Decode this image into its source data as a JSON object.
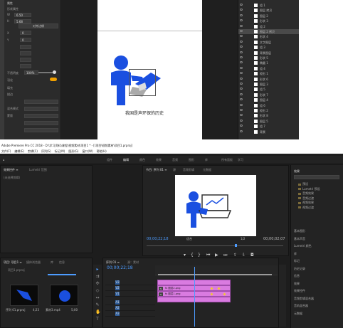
{
  "photoshop": {
    "props_header": "属性",
    "props_title": "形状属性",
    "w_label": "W",
    "w_value": "6.50",
    "h_label": "H",
    "h_value": "5.68",
    "x_label": "X",
    "x_value": "0",
    "y_label": "Y",
    "y_value": "0",
    "align_button": "对齐边缘",
    "opacity_label": "不透明度",
    "opacity_value": "100%",
    "toggle_label": "羽化",
    "fill_label": "填充",
    "stroke_label": "描边",
    "mode_label": "混合模式",
    "mask_label": "蒙版",
    "layers": [
      {
        "label": "组 1",
        "sel": false
      },
      {
        "label": "图层 拷贝",
        "sel": false
      },
      {
        "label": "图层 2",
        "sel": false
      },
      {
        "label": "形状 3",
        "sel": false
      },
      {
        "label": "组 2",
        "sel": false
      },
      {
        "label": "图层 2 拷贝",
        "sel": true
      },
      {
        "label": "形状 4",
        "sel": false
      },
      {
        "label": "文字图层",
        "sel": false
      },
      {
        "label": "组 3",
        "sel": false
      },
      {
        "label": "背景图层",
        "sel": false
      },
      {
        "label": "形状 5",
        "sel": false
      },
      {
        "label": "椭圆 1",
        "sel": false
      },
      {
        "label": "组 4",
        "sel": false
      },
      {
        "label": "矩形 1",
        "sel": false
      },
      {
        "label": "形状 6",
        "sel": false
      },
      {
        "label": "图层 3",
        "sel": false
      },
      {
        "label": "组 5",
        "sel": false
      },
      {
        "label": "形状 7",
        "sel": false
      },
      {
        "label": "图层 4",
        "sel": false
      },
      {
        "label": "组 6",
        "sel": false
      },
      {
        "label": "矩形 2",
        "sel": false
      },
      {
        "label": "形状 8",
        "sel": false
      },
      {
        "label": "图层 5",
        "sel": false
      },
      {
        "label": "组 7",
        "sel": false
      },
      {
        "label": "背景",
        "sel": false
      }
    ],
    "caption": "我国是声环保的历史"
  },
  "premiere": {
    "title": "Adobe Premiere Pro CC 2018 - D:\\学习资料\\课程\\视频素材\\项目1 * - [\\项目\\视频素材\\项目1.prproj]",
    "menu": [
      "文件(F)",
      "编辑(E)",
      "剪辑(C)",
      "序列(S)",
      "标记(M)",
      "图形(G)",
      "窗口(W)",
      "帮助(H)"
    ],
    "workspace_tabs": [
      "组件",
      "编辑",
      "颜色",
      "效果",
      "音频",
      "图形",
      "库",
      "所有面板",
      "学习"
    ],
    "source_tabs": [
      "效果控件 ≡",
      "Lumetri 范围"
    ],
    "source_empty": "(未选择剪辑)",
    "program_tabs": [
      "节目: 序列 01 ≡",
      "源",
      "音频剪辑",
      "元数据"
    ],
    "program_tc_left": "00;00;22;18",
    "program_tc_right": "00;00;02;07",
    "program_zoom": "适合",
    "program_quality": "1/2",
    "timeline_tabs": [
      "序列 01 ≡",
      "源：素材"
    ],
    "timeline_tc": "00;00;22;18",
    "project_tabs": [
      "项目: 项目1 ≡",
      "媒体浏览器",
      "库",
      "信息"
    ],
    "project_path": "项目1.prproj",
    "project_items": [
      {
        "name": "序列 01.prproj",
        "dur": "4;23"
      },
      {
        "name": "素材3.mp4",
        "dur": "5;00"
      }
    ],
    "tracks": [
      "V3",
      "V2",
      "V1",
      "A1",
      "A2",
      "A3"
    ],
    "clips": [
      {
        "label": "fx  图层2.png",
        "track": 1
      },
      {
        "label": "fx  图层1.png",
        "track": 2
      }
    ],
    "right_panel_title": "效果",
    "right_items": [
      "预设",
      "Lumetri 预设",
      "音频效果",
      "音频过渡",
      "视频效果",
      "视频过渡"
    ],
    "right_bottom_items": [
      "基本图形",
      "基本声音",
      "Lumetri 颜色",
      "库",
      "标记",
      "历史记录",
      "信息",
      "效果",
      "效果控件",
      "音频剪辑混合器",
      "音轨混合器",
      "元数据"
    ]
  }
}
